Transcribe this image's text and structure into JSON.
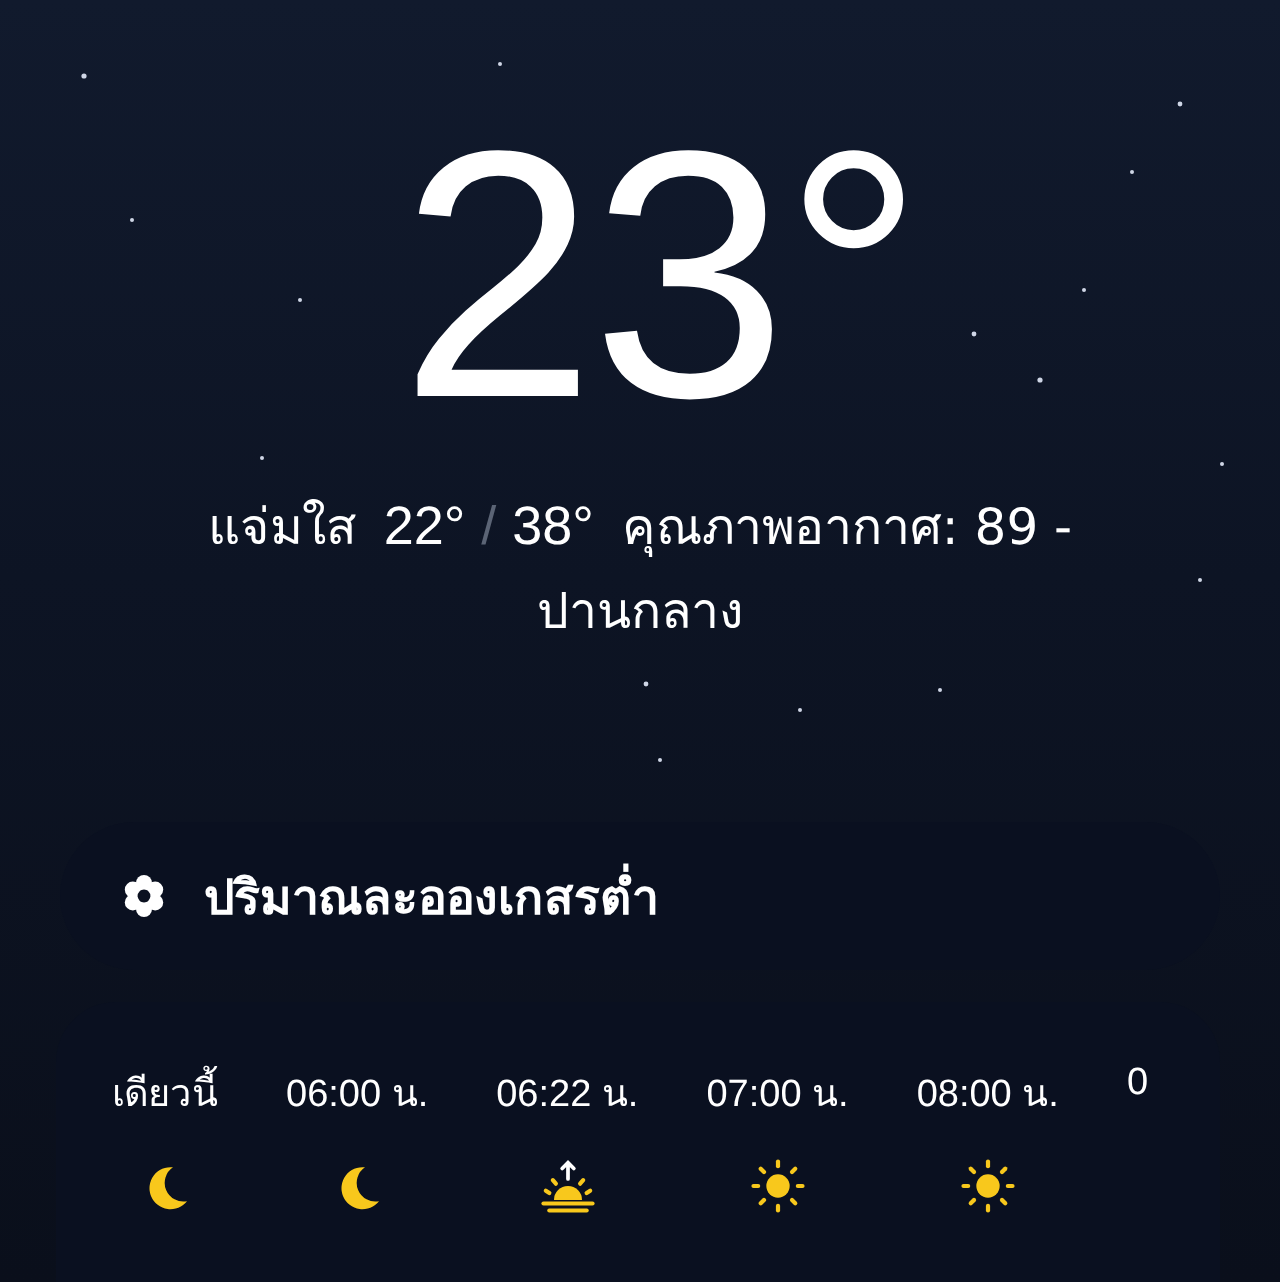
{
  "current": {
    "temperature": "23°",
    "condition": "แจ่มใส",
    "low": "22°",
    "separator": "/",
    "high": "38°",
    "air_quality": "คุณภาพอากาศ: 89 - ปานกลาง"
  },
  "pollen": {
    "text": "ปริมาณละอองเกสรต่ำ"
  },
  "hourly": [
    {
      "time": "เดียวนี้",
      "kind": "moon"
    },
    {
      "time": "06:00 น.",
      "kind": "moon"
    },
    {
      "time": "06:22 น.",
      "kind": "sunrise"
    },
    {
      "time": "07:00 น.",
      "kind": "sun"
    },
    {
      "time": "08:00 น.",
      "kind": "sun"
    },
    {
      "time": "0"
    }
  ]
}
